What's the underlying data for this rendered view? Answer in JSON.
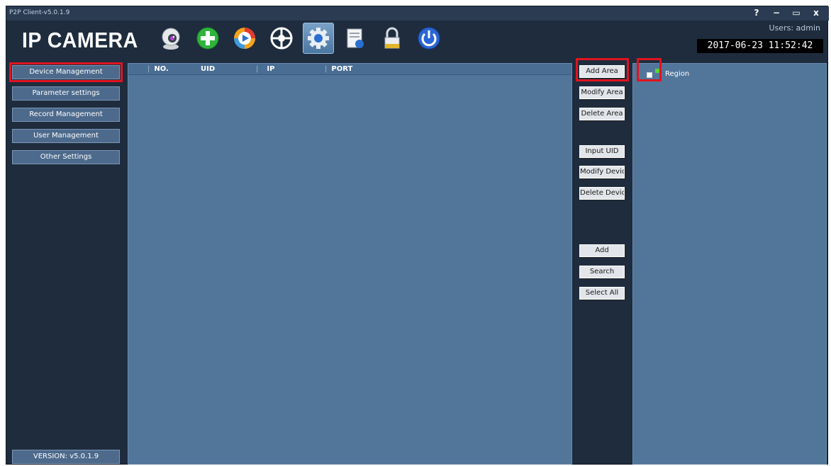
{
  "window": {
    "title": "P2P Client-v5.0.1.9",
    "controls": [
      "?",
      "−",
      "▭",
      "x"
    ]
  },
  "header": {
    "logo": "IP CAMERA",
    "users": "Users: admin",
    "datetime": "2017-06-23 11:52:42",
    "toolbar": [
      {
        "icon": "camera-icon"
      },
      {
        "icon": "add-icon"
      },
      {
        "icon": "playback-icon"
      },
      {
        "icon": "ptz-icon"
      },
      {
        "icon": "settings-icon",
        "active": true
      },
      {
        "icon": "log-icon"
      },
      {
        "icon": "lock-icon"
      },
      {
        "icon": "power-icon"
      }
    ]
  },
  "sidebar": {
    "items": [
      {
        "label": "Device Management",
        "highlighted": true
      },
      {
        "label": "Parameter settings"
      },
      {
        "label": "Record Management"
      },
      {
        "label": "User Management"
      },
      {
        "label": "Other Settings"
      }
    ],
    "version": "VERSION: v5.0.1.9"
  },
  "device_table": {
    "columns": [
      "NO.",
      "UID",
      "IP",
      "PORT"
    ],
    "rows": []
  },
  "actions": {
    "add_area": "Add Area",
    "modify_area": "Modify Area",
    "delete_area": "Delete Area",
    "input_uid": "Input UID",
    "modify_device": "Modify Device",
    "delete_device": "Delete Device",
    "add": "Add",
    "search": "Search",
    "select_all": "Select All"
  },
  "region_tree": {
    "root_label": "Region"
  },
  "colors": {
    "background": "#1e2c3e",
    "panel": "#52769a",
    "highlight": "#e0141e"
  }
}
